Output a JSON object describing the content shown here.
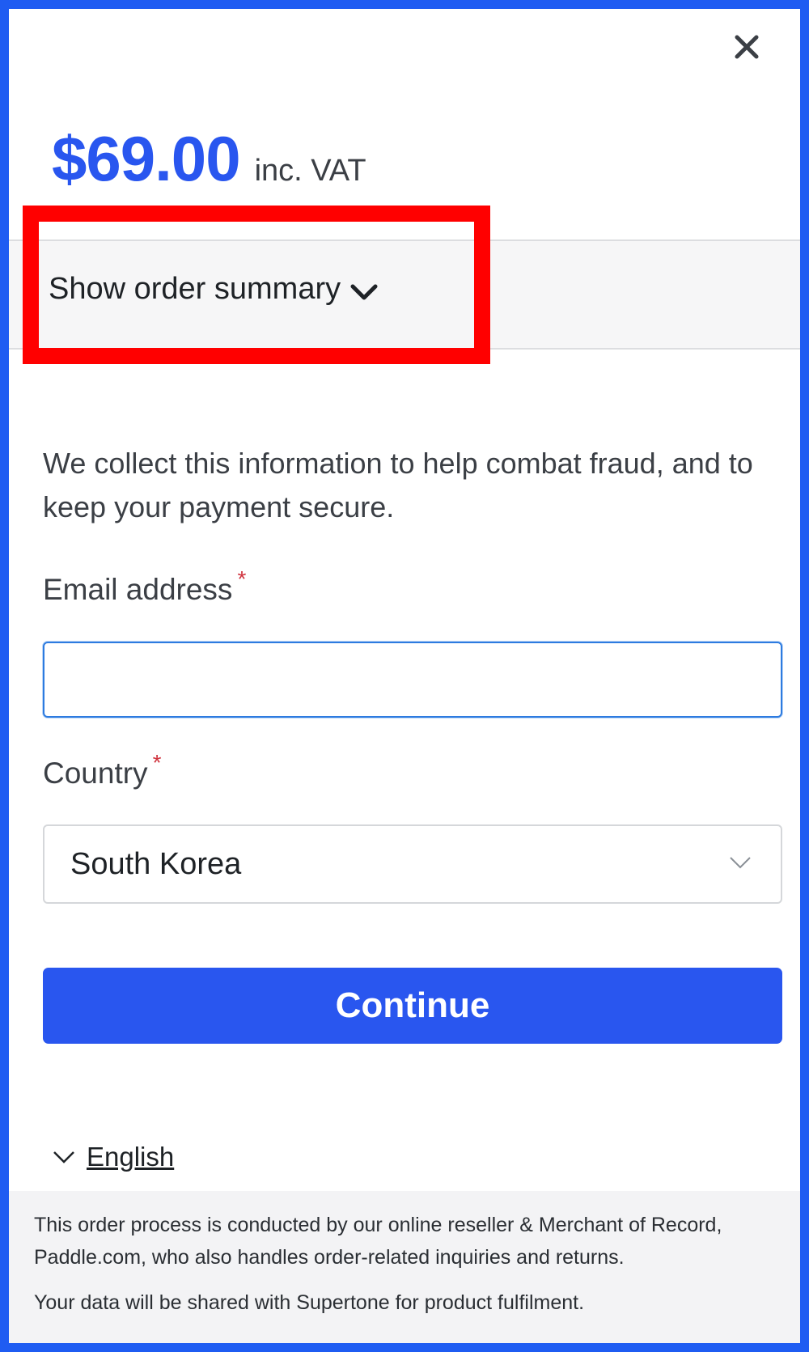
{
  "header": {
    "close_icon": "close-icon",
    "price": "$69.00",
    "price_suffix": "inc. VAT"
  },
  "summary": {
    "toggle_label": "Show order summary",
    "chevron_icon": "chevron-down-icon"
  },
  "form": {
    "info_text": "We collect this information to help combat fraud, and to keep your payment secure.",
    "email_label": "Email address",
    "email_value": "",
    "required_marker": "*",
    "country_label": "Country",
    "country_value": "South Korea",
    "continue_label": "Continue"
  },
  "language": {
    "label": "English",
    "chevron_icon": "chevron-down-icon"
  },
  "footer": {
    "line1": "This order process is conducted by our online reseller & Merchant of Record, Paddle.com, who also handles order-related inquiries and returns.",
    "line2": "Your data will be shared with Supertone for product fulfilment."
  },
  "colors": {
    "accent": "#2956ef",
    "frame_border": "#1f5cf2",
    "highlight": "#ff0000",
    "required": "#d0343f"
  }
}
